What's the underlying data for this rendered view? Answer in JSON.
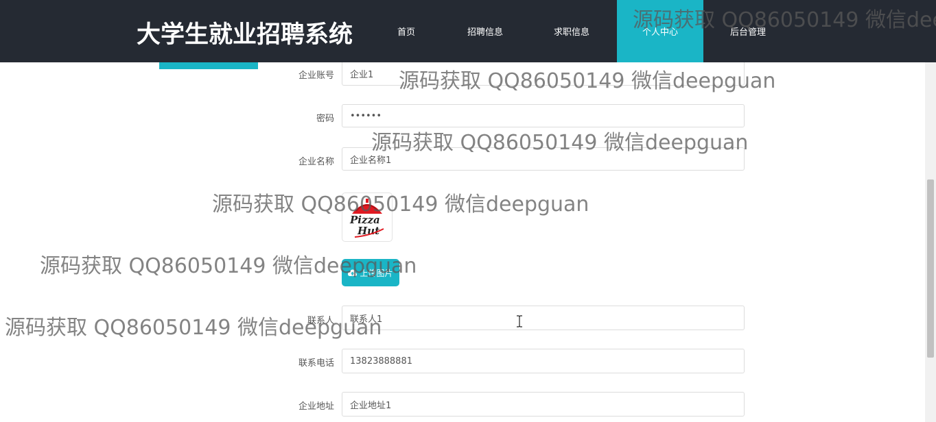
{
  "header": {
    "brand": "大学生就业招聘系统",
    "nav": [
      {
        "label": "首页",
        "active": false
      },
      {
        "label": "招聘信息",
        "active": false
      },
      {
        "label": "求职信息",
        "active": false
      },
      {
        "label": "个人中心",
        "active": true
      },
      {
        "label": "后台管理",
        "active": false
      }
    ]
  },
  "form": {
    "account_label": "企业账号",
    "account_value": "企业1",
    "password_label": "密码",
    "password_value": "••••••",
    "company_name_label": "企业名称",
    "company_name_value": "企业名称1",
    "logo_text_top": "Pizza",
    "logo_text_bottom": "Hut",
    "upload_label": "上传图片",
    "contact_label": "联系人",
    "contact_value": "联系人1",
    "phone_label": "联系电话",
    "phone_value": "13823888881",
    "address_label": "企业地址",
    "address_value": "企业地址1"
  },
  "watermarks": [
    "源码获取 QQ86050149 微信dee",
    "源码获取 QQ86050149 微信deepguan",
    "源码获取 QQ86050149 微信deepguan",
    "源码获取 QQ86050149 微信deepguan",
    "源码获取 QQ86050149 微信deepguan",
    "源码获取 QQ86050149 微信deepguan"
  ],
  "colors": {
    "header_bg": "#252a33",
    "accent": "#1ab5c6"
  }
}
